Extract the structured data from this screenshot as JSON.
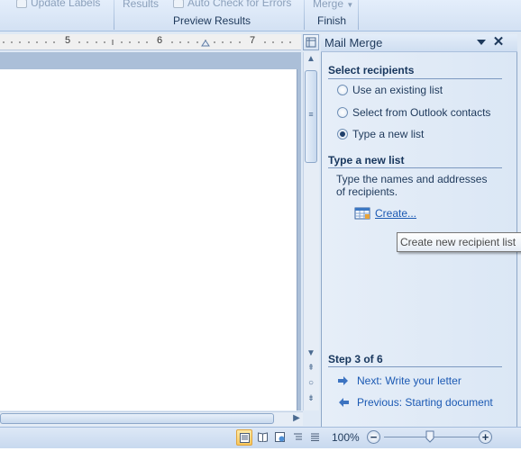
{
  "ribbon": {
    "update_labels": "Update Labels",
    "results": "Results",
    "auto_check": "Auto Check for Errors",
    "merge": "Merge",
    "preview_group": "Preview Results",
    "finish_group": "Finish"
  },
  "ruler": {
    "ticks": [
      "5",
      "6",
      "7"
    ]
  },
  "pane": {
    "title": "Mail Merge",
    "select_heading": "Select recipients",
    "options": [
      {
        "label": "Use an existing list",
        "checked": false
      },
      {
        "label": "Select from Outlook contacts",
        "checked": false
      },
      {
        "label": "Type a new list",
        "checked": true
      }
    ],
    "type_heading": "Type a new list",
    "description": "Type the names and addresses of recipients.",
    "create_link": "Create...",
    "tooltip": "Create new recipient list",
    "step": "Step 3 of 6",
    "next": "Next: Write your letter",
    "previous": "Previous: Starting document"
  },
  "status": {
    "zoom": "100%",
    "zoom_level_percent": 100
  },
  "colors": {
    "accent": "#1b59b3",
    "pane_bg": "#dbe7f5",
    "active_view": "#f7c75c"
  }
}
